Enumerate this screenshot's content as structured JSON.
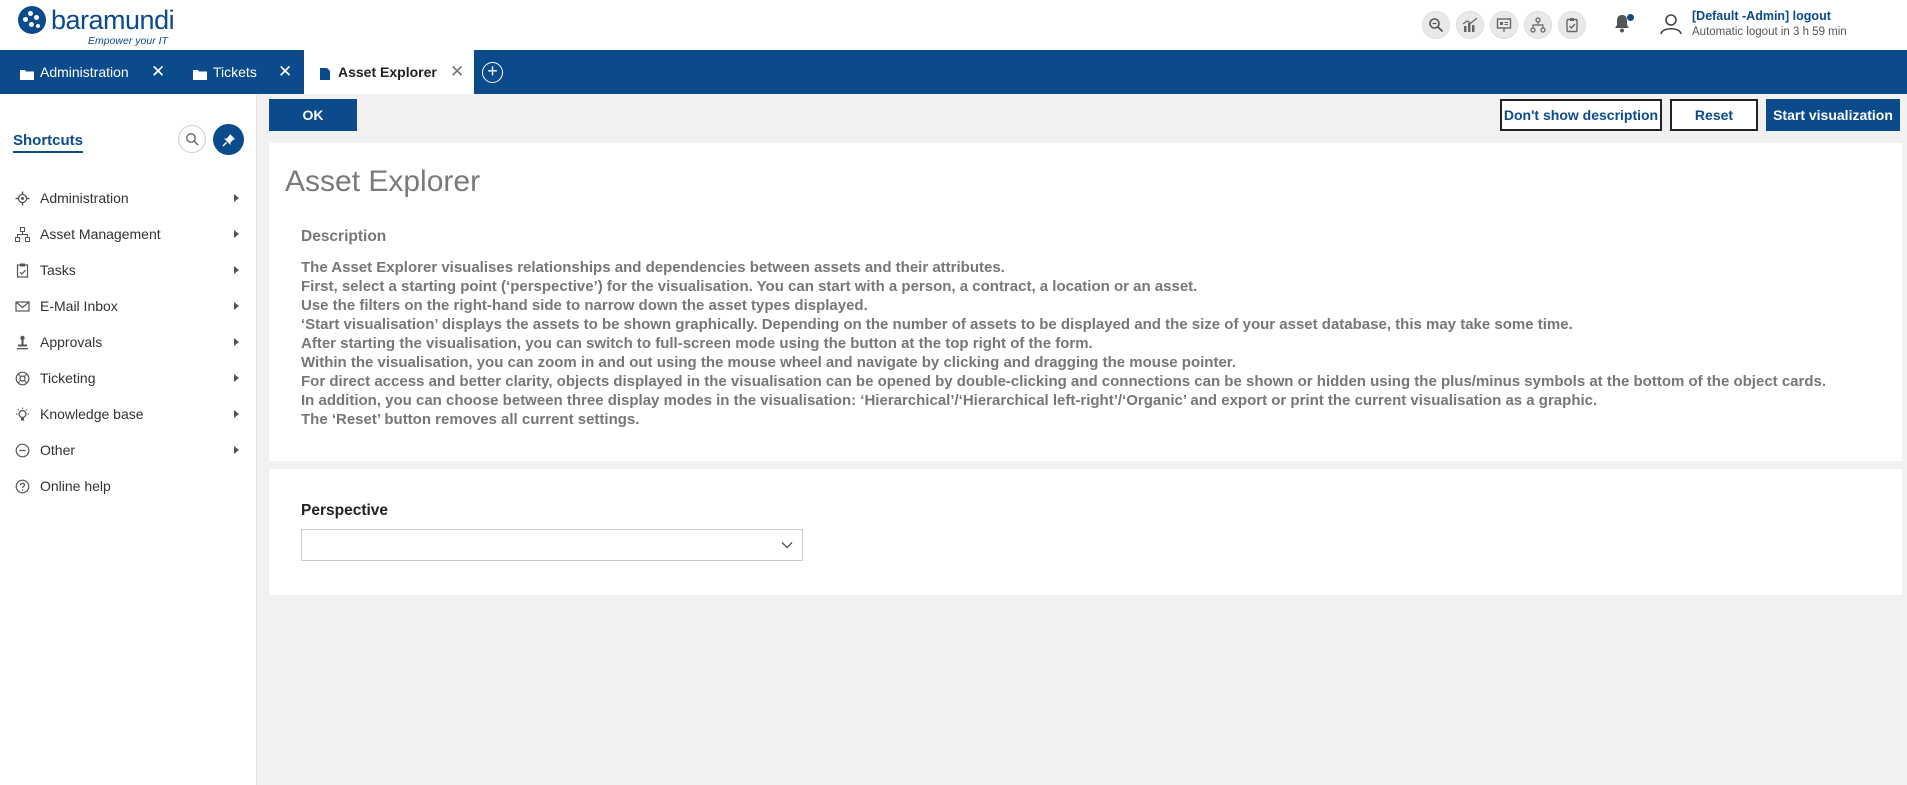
{
  "brand": {
    "name": "baramundi",
    "tagline": "Empower your IT",
    "color": "#0b4a8b"
  },
  "header": {
    "tool_icons": [
      "magnifier-icon",
      "chart-icon",
      "presentation-icon",
      "hierarchy-icon",
      "clipboard-check-icon"
    ],
    "user_name": "[Default -Admin]  logout",
    "logout_info": "Automatic logout in 3 h 59 min"
  },
  "tabs": [
    {
      "label": "Administration",
      "icon": "folder-icon",
      "active": false
    },
    {
      "label": "Tickets",
      "icon": "folder-icon",
      "active": false
    },
    {
      "label": "Asset Explorer",
      "icon": "document-icon",
      "active": true
    }
  ],
  "sidebar": {
    "title": "Shortcuts",
    "items": [
      {
        "label": "Administration",
        "icon": "gear-icon",
        "submenu": true
      },
      {
        "label": "Asset Management",
        "icon": "hierarchy-icon",
        "submenu": true
      },
      {
        "label": "Tasks",
        "icon": "clipboard-icon",
        "submenu": true
      },
      {
        "label": "E-Mail Inbox",
        "icon": "mail-icon",
        "submenu": true
      },
      {
        "label": "Approvals",
        "icon": "stamp-icon",
        "submenu": true
      },
      {
        "label": "Ticketing",
        "icon": "ticketing-icon",
        "submenu": true
      },
      {
        "label": "Knowledge base",
        "icon": "lightbulb-icon",
        "submenu": true
      },
      {
        "label": "Other",
        "icon": "more-icon",
        "submenu": true
      },
      {
        "label": "Online help",
        "icon": "help-icon",
        "submenu": false
      }
    ]
  },
  "toolbar": {
    "ok_label": "OK",
    "hide_desc_label": "Don't show description",
    "reset_label": "Reset",
    "start_label": "Start visualization"
  },
  "main": {
    "title": "Asset Explorer",
    "description_heading": "Description",
    "description_lines": [
      "The Asset Explorer visualises relationships and dependencies between assets and their attributes.",
      "First, select a starting point (‘perspective’) for the visualisation. You can start with a person, a contract, a location or an asset.",
      "Use the filters on the right-hand side to narrow down the asset types displayed.",
      "‘Start visualisation’ displays the assets to be shown graphically. Depending on the number of assets to be displayed and the size of your asset database, this may take some time.",
      "After starting the visualisation, you can switch to full-screen mode using the button at the top right of the form.",
      "Within the visualisation, you can zoom in and out using the mouse wheel and navigate by clicking and dragging the mouse pointer.",
      "For direct access and better clarity, objects displayed in the visualisation can be opened by double-clicking and connections can be shown or hidden using the plus/minus symbols at the bottom of the object cards.",
      "In addition, you can choose between three display modes in the visualisation: ‘Hierarchical’/‘Hierarchical left-right’/‘Organic’ and export or print the current visualisation as a graphic.",
      "The ‘Reset’ button removes all current settings."
    ],
    "perspective_label": "Perspective",
    "perspective_value": ""
  }
}
